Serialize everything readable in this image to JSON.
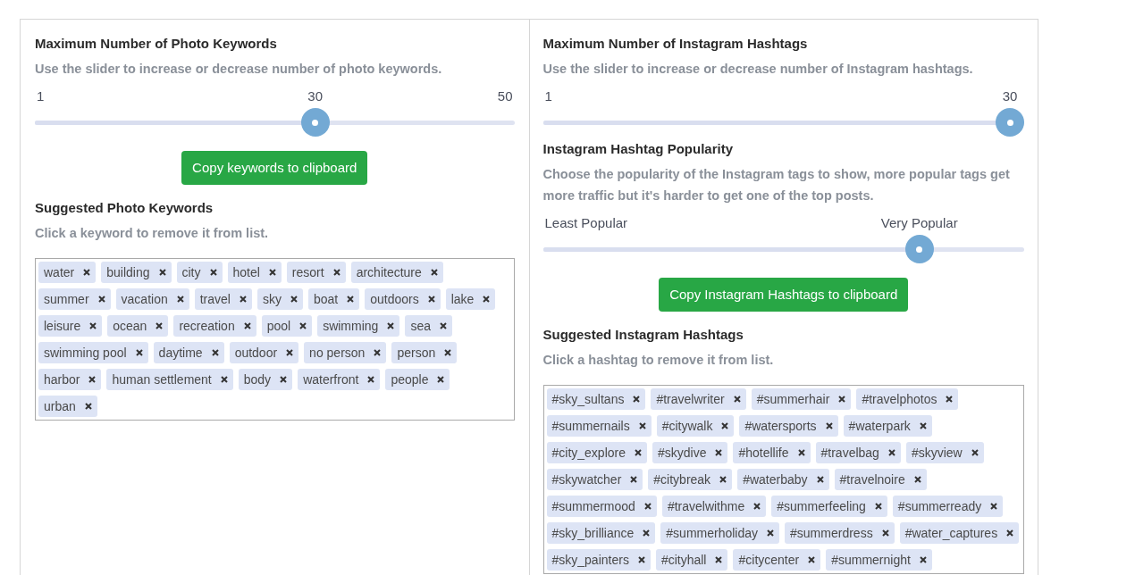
{
  "keywords_panel": {
    "title": "Maximum Number of Photo Keywords",
    "description": "Use the slider to increase or decrease number of photo keywords.",
    "slider": {
      "min_label": "1",
      "value_label": "30",
      "max_label": "50",
      "level": 0.59
    },
    "copy_button": "Copy keywords to clipboard",
    "list_title": "Suggested Photo Keywords",
    "list_hint": "Click a keyword to remove it from list.",
    "tags": [
      "water",
      "building",
      "city",
      "hotel",
      "resort",
      "architecture",
      "summer",
      "vacation",
      "travel",
      "sky",
      "boat",
      "outdoors",
      "lake",
      "leisure",
      "ocean",
      "recreation",
      "pool",
      "swimming",
      "sea",
      "swimming pool",
      "daytime",
      "outdoor",
      "no person",
      "person",
      "harbor",
      "human settlement",
      "body",
      "waterfront",
      "people",
      "urban"
    ]
  },
  "hashtags_panel": {
    "title": "Maximum Number of Instagram Hashtags",
    "description": "Use the slider to increase or decrease number of Instagram hashtags.",
    "slider": {
      "min_label": "1",
      "value_label": "30",
      "level": 1
    },
    "popularity_title": "Instagram Hashtag Popularity",
    "popularity_description": "Choose the popularity of the Instagram tags to show, more popular tags get more traffic but it's harder to get one of the top posts.",
    "popularity_slider": {
      "min_label": "Least Popular",
      "value_label": "Very Popular",
      "level": 0.8
    },
    "copy_button": "Copy Instagram Hashtags to clipboard",
    "list_title": "Suggested Instagram Hashtags",
    "list_hint": "Click a hashtag to remove it from list.",
    "tags": [
      "#sky_sultans",
      "#travelwriter",
      "#summerhair",
      "#travelphotos",
      "#summernails",
      "#citywalk",
      "#watersports",
      "#waterpark",
      "#city_explore",
      "#skydive",
      "#hotellife",
      "#travelbag",
      "#skyview",
      "#skywatcher",
      "#citybreak",
      "#waterbaby",
      "#travelnoire",
      "#summermood",
      "#travelwithme",
      "#summerfeeling",
      "#summerready",
      "#sky_brilliance",
      "#summerholiday",
      "#summerdress",
      "#water_captures",
      "#sky_painters",
      "#cityhall",
      "#citycenter",
      "#summernight"
    ]
  }
}
